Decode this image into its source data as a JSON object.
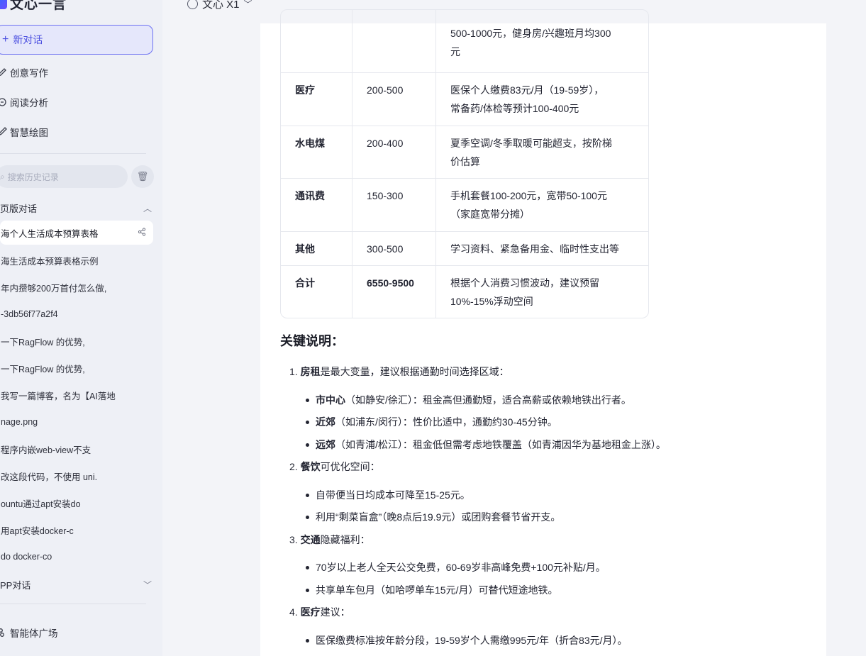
{
  "app": {
    "brand": "文心一言",
    "model": "文心 X1"
  },
  "sidebar": {
    "new_chat": "新对话",
    "nav": [
      {
        "label": "创意写作",
        "icon": "pen-icon"
      },
      {
        "label": "阅读分析",
        "icon": "read-icon"
      },
      {
        "label": "智慧绘图",
        "icon": "brush-icon"
      }
    ],
    "search_placeholder": "搜索历史记录",
    "web_section": "页版对话",
    "history": [
      "海个人生活成本预算表格",
      "海生活成本预算表格示例",
      "年内攒够200万首付怎么做,",
      "-3db56f77a2f4",
      "一下RagFlow 的优势,",
      "一下RagFlow 的优势,",
      "我写一篇博客，名为【AI落地",
      "nage.png",
      "程序内嵌web-view不支",
      "改这段代码，不使用 uni.",
      "ountu通过apt安装do",
      "用apt安装docker-c",
      "do docker-co"
    ],
    "app_section": "PP对话",
    "agent_plaza": "智能体广场"
  },
  "table": {
    "rows": [
      {
        "item": "",
        "amount": "",
        "note_lines": [
          "500-1000元，健身房/兴趣班月均300",
          "元"
        ]
      },
      {
        "item": "医疗",
        "amount": "200-500",
        "note_lines": [
          "医保个人缴费83元/月（19-59岁），",
          "常备药/体检等预计100-400元"
        ]
      },
      {
        "item": "水电煤",
        "amount": "200-400",
        "note_lines": [
          "夏季空调/冬季取暖可能超支，按阶梯",
          "价估算"
        ]
      },
      {
        "item": "通讯费",
        "amount": "150-300",
        "note_lines": [
          "手机套餐100-200元，宽带50-100元",
          "（家庭宽带分摊）"
        ]
      },
      {
        "item": "其他",
        "amount": "300-500",
        "note_lines": [
          "学习资料、紧急备用金、临时性支出等"
        ]
      },
      {
        "item": "合计",
        "amount": "6550-9500",
        "note_lines": [
          "根据个人消费习惯波动，建议预留",
          "10%-15%浮动空间"
        ]
      }
    ]
  },
  "notes": {
    "heading": "关键说明：",
    "items": [
      {
        "num": "1.",
        "key": "房租",
        "text": "是最大变量，建议根据通勤时间选择区域：",
        "bullets": [
          {
            "key": "市中心",
            "text": "（如静安/徐汇）：租金高但通勤短，适合高薪或依赖地铁出行者。"
          },
          {
            "key": "近郊",
            "text": "（如浦东/闵行）：性价比适中，通勤约30-45分钟。"
          },
          {
            "key": "远郊",
            "text": "（如青浦/松江）：租金低但需考虑地铁覆盖（如青浦因华为基地租金上涨）。"
          }
        ]
      },
      {
        "num": "2.",
        "key": "餐饮",
        "text": "可优化空间：",
        "bullets": [
          {
            "key": "",
            "text": "自带便当日均成本可降至15-25元。"
          },
          {
            "key": "",
            "text": "利用“剩菜盲盒”（晚8点后19.9元）或团购套餐节省开支。"
          }
        ]
      },
      {
        "num": "3.",
        "key": "交通",
        "text": "隐藏福利：",
        "bullets": [
          {
            "key": "",
            "text": "70岁以上老人全天公交免费，60-69岁非高峰免费+100元补贴/月。"
          },
          {
            "key": "",
            "text": "共享单车包月（如哈啰单车15元/月）可替代短途地铁。"
          }
        ]
      },
      {
        "num": "4.",
        "key": "医疗",
        "text": "建议：",
        "bullets": [
          {
            "key": "",
            "text": "医保缴费标准按年龄分段，19-59岁个人需缴995元/年（折合83元/月）。"
          }
        ]
      }
    ]
  }
}
